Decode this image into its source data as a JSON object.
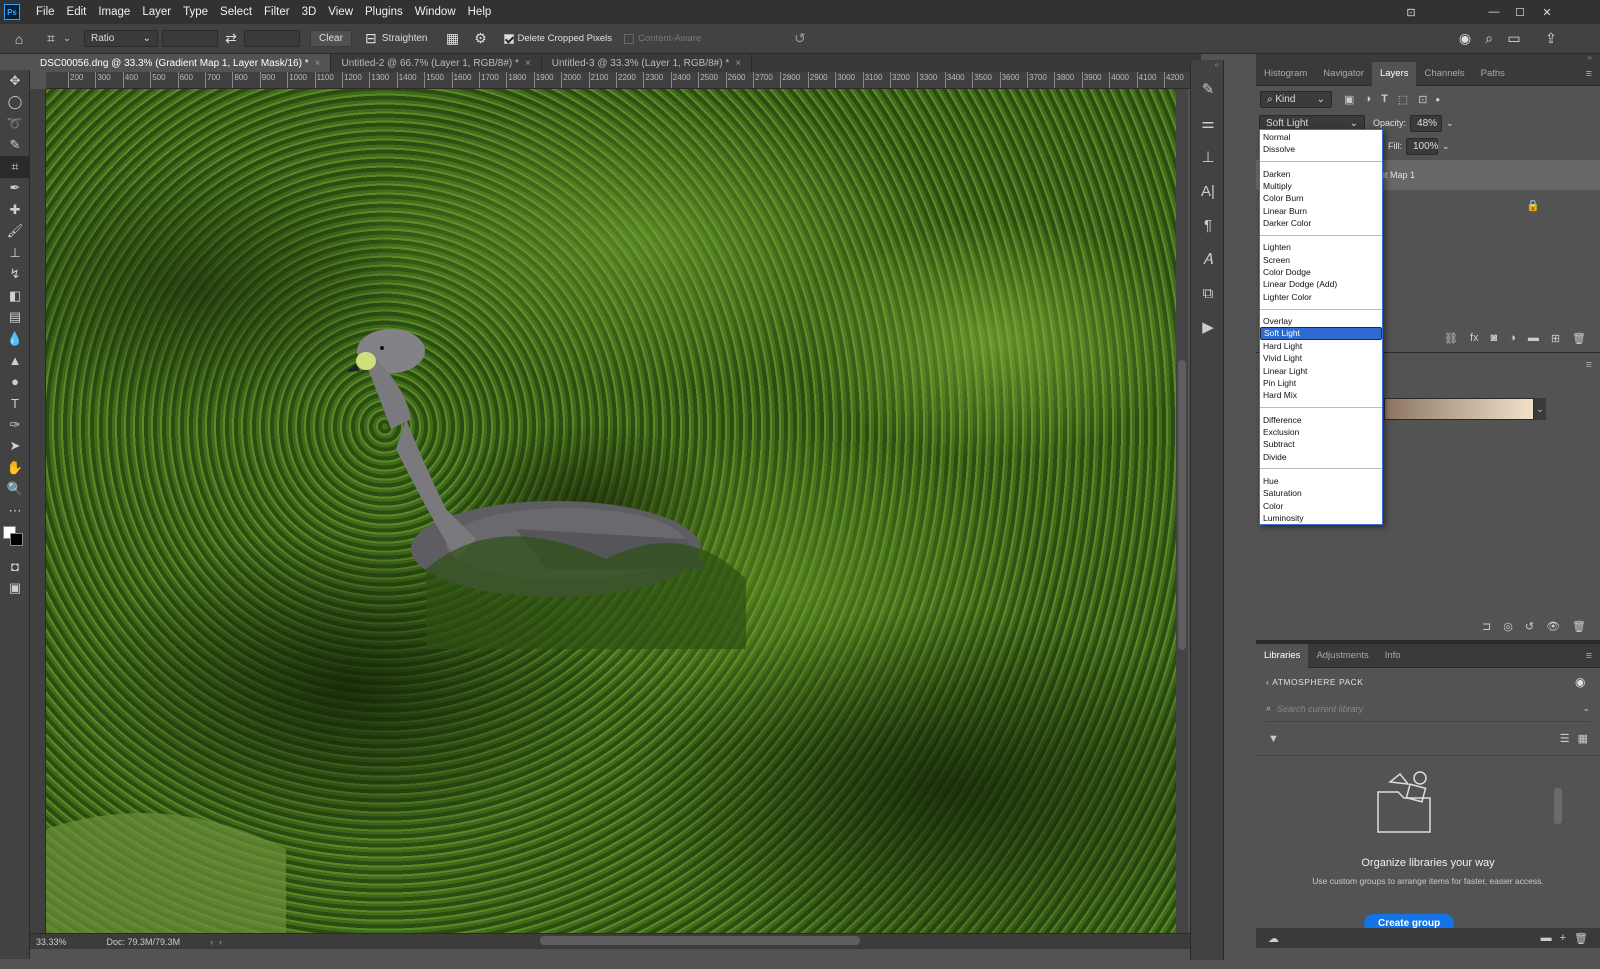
{
  "menubar": {
    "logo": "Ps",
    "items": [
      "File",
      "Edit",
      "Image",
      "Layer",
      "Type",
      "Select",
      "Filter",
      "3D",
      "View",
      "Plugins",
      "Window",
      "Help"
    ]
  },
  "options": {
    "ratio": "Ratio",
    "clear": "Clear",
    "straighten": "Straighten",
    "delete_cropped": "Delete Cropped Pixels",
    "content_aware": "Content-Aware"
  },
  "tabs": [
    {
      "label": "DSC00056.dng @ 33.3% (Gradient Map 1, Layer Mask/16) *",
      "active": true
    },
    {
      "label": "Untitled-2 @ 66.7% (Layer 1, RGB/8#) *",
      "active": false
    },
    {
      "label": "Untitled-3 @ 33.3% (Layer 1, RGB/8#) *",
      "active": false
    }
  ],
  "ruler": [
    "200",
    "300",
    "400",
    "500",
    "600",
    "700",
    "800",
    "900",
    "1000",
    "1100",
    "1200",
    "1300",
    "1400",
    "1500",
    "1600",
    "1700",
    "1800",
    "1900",
    "2000",
    "2100",
    "2200",
    "2300",
    "2400",
    "2500",
    "2600",
    "2700",
    "2800",
    "2900",
    "3000",
    "3100",
    "3200",
    "3300",
    "3400",
    "3500",
    "3600",
    "3700",
    "3800",
    "3900",
    "4000",
    "4100",
    "4200"
  ],
  "status": {
    "zoom": "33.33%",
    "doc": "Doc: 79.3M/79.3M"
  },
  "layers_panel": {
    "tabs": [
      "Histogram",
      "Navigator",
      "Layers",
      "Channels",
      "Paths"
    ],
    "active_tab": "Layers",
    "filter_kind": "Kind",
    "blend_mode": "Soft Light",
    "opacity_label": "Opacity:",
    "opacity": "48%",
    "fill_label": "Fill:",
    "fill": "100%",
    "layer_name_partial": "nt Map 1"
  },
  "blend_modes": [
    [
      "Normal",
      "Dissolve"
    ],
    [
      "Darken",
      "Multiply",
      "Color Burn",
      "Linear Burn",
      "Darker Color"
    ],
    [
      "Lighten",
      "Screen",
      "Color Dodge",
      "Linear Dodge (Add)",
      "Lighter Color"
    ],
    [
      "Overlay",
      "Soft Light",
      "Hard Light",
      "Vivid Light",
      "Linear Light",
      "Pin Light",
      "Hard Mix"
    ],
    [
      "Difference",
      "Exclusion",
      "Subtract",
      "Divide"
    ],
    [
      "Hue",
      "Saturation",
      "Color",
      "Luminosity"
    ]
  ],
  "selected_mode": "Soft Light",
  "libraries": {
    "tabs": [
      "Libraries",
      "Adjustments",
      "Info"
    ],
    "library_name": "ATMOSPHERE PACK",
    "search_placeholder": "Search current library",
    "empty_title": "Organize libraries your way",
    "empty_desc": "Use custom groups to arrange items for faster, easier access.",
    "create_button": "Create group"
  },
  "colors": {
    "accent": "#1473e6",
    "selection": "#2f6ad0"
  }
}
